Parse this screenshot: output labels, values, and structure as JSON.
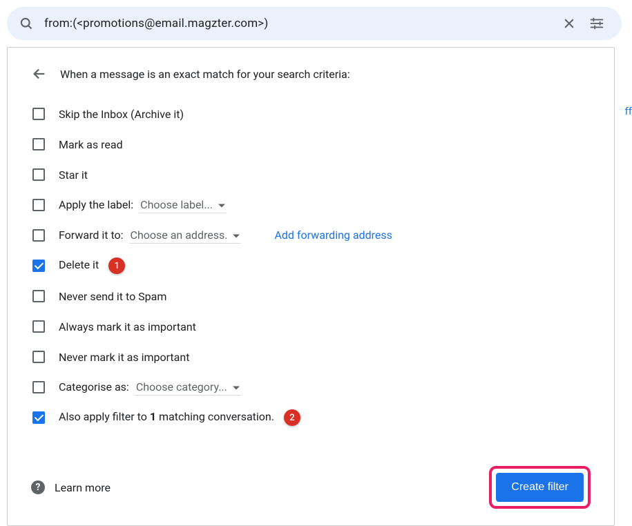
{
  "search": {
    "query": "from:(<promotions@email.magzter.com>)"
  },
  "panel": {
    "title": "When a message is an exact match for your search criteria:"
  },
  "options": {
    "skip_inbox": "Skip the Inbox (Archive it)",
    "mark_read": "Mark as read",
    "star_it": "Star it",
    "apply_label": "Apply the label:",
    "apply_label_dd": "Choose label...",
    "forward_to": "Forward it to:",
    "forward_to_dd": "Choose an address.",
    "forward_link": "Add forwarding address",
    "delete_it": "Delete it",
    "never_spam": "Never send it to Spam",
    "always_important": "Always mark it as important",
    "never_important": "Never mark it as important",
    "categorise": "Categorise as:",
    "categorise_dd": "Choose category...",
    "also_apply_pre": "Also apply filter to ",
    "also_apply_count": "1",
    "also_apply_post": " matching conversation."
  },
  "badges": {
    "b1": "1",
    "b2": "2"
  },
  "footer": {
    "learn_more": "Learn more",
    "create_filter": "Create filter"
  },
  "artifact": "ff"
}
